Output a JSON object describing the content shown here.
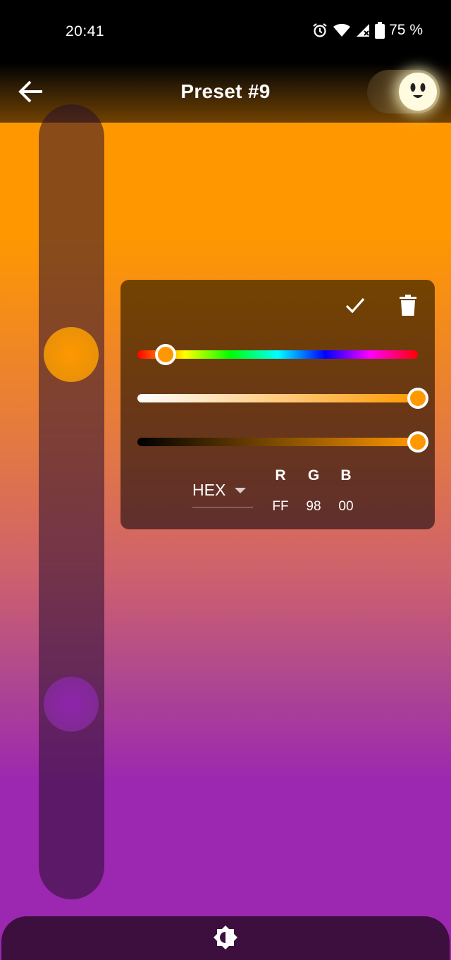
{
  "status_bar": {
    "time": "20:41",
    "battery": "75 %",
    "icons": [
      "alarm-icon",
      "wifi-icon",
      "cellular-no-signal-icon",
      "battery-icon"
    ]
  },
  "app_bar": {
    "title": "Preset #9",
    "back_icon": "arrow-left-icon",
    "toggle_state": "on"
  },
  "gradient": {
    "colors": [
      "#ff9800",
      "#9c27b0"
    ],
    "stops": [
      {
        "color": "#ff9800"
      },
      {
        "color": "#8e24aa"
      }
    ]
  },
  "color_picker": {
    "confirm_icon": "check-icon",
    "delete_icon": "trash-icon",
    "mode": "HEX",
    "channels": [
      {
        "label": "R",
        "value": "FF"
      },
      {
        "label": "G",
        "value": "98"
      },
      {
        "label": "B",
        "value": "00"
      }
    ],
    "hue_position": 0.1,
    "saturation": 1.0,
    "value": 1.0,
    "selected_color": "#ff9800"
  },
  "bottom_bar": {
    "icon": "brightness-icon"
  }
}
